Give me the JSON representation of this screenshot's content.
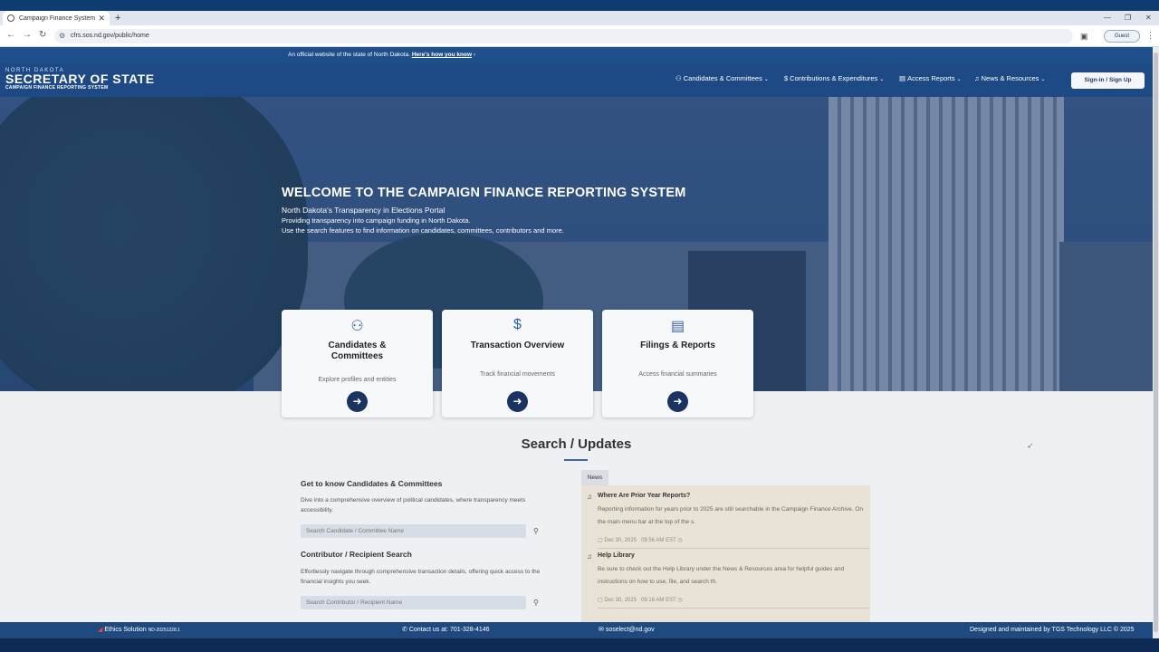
{
  "browser": {
    "tab_title": "Campaign Finance System",
    "url": "cfrs.sos.nd.gov/public/home",
    "profile_label": "Guest"
  },
  "banner": {
    "official_text": "An official website of the state of North Dakota.",
    "how_link": "Here's how you know"
  },
  "logo": {
    "line1": "NORTH DAKOTA",
    "line2": "SECRETARY OF STATE",
    "line3": "CAMPAIGN FINANCE REPORTING SYSTEM"
  },
  "nav": {
    "items": [
      {
        "label": "Candidates & Committees",
        "icon": "people-icon"
      },
      {
        "label": "Contributions & Expenditures",
        "icon": "dollar-icon"
      },
      {
        "label": "Access Reports",
        "icon": "document-icon"
      },
      {
        "label": "News & Resources",
        "icon": "bell-icon"
      }
    ],
    "signin_label": "Sign-in / Sign Up"
  },
  "hero": {
    "title": "WELCOME TO THE CAMPAIGN FINANCE REPORTING SYSTEM",
    "subtitle": "North Dakota's Transparency in Elections Portal",
    "line1": "Providing transparency into campaign funding in North Dakota.",
    "line2": "Use the search features to find information on candidates, committees, contributors and more."
  },
  "cards": [
    {
      "title_line1": "Candidates &",
      "title_line2": "Committees",
      "desc": "Explore profiles and entities",
      "icon": "people-icon"
    },
    {
      "title_line1": "Transaction Overview",
      "title_line2": "",
      "desc": "Track financial movements",
      "icon": "dollar-icon"
    },
    {
      "title_line1": "Filings & Reports",
      "title_line2": "",
      "desc": "Access financial summaries",
      "icon": "document-icon"
    }
  ],
  "search": {
    "section_title": "Search / Updates",
    "candidates_heading": "Get to know Candidates & Committees",
    "candidates_desc": "Dive into a comprehensive overview of political candidates, where transparency meets accessibility.",
    "candidates_placeholder": "Search Candidate / Committee Name",
    "contributor_heading": "Contributor / Recipient Search",
    "contributor_desc": "Effortlessly navigate through comprehensive transaction details, offering quick access to the financial insights you seek.",
    "contributor_placeholder": "Search Contributor / Recipient Name"
  },
  "news": {
    "tab_label": "News",
    "items": [
      {
        "title": "Where Are Prior Year Reports?",
        "body": "Reporting information for years prior to 2025 are still searchable in the Campaign Finance Archive. On the main menu bar at the top of the s.",
        "date": "Dec 30, 2025",
        "time": "09:56 AM EST"
      },
      {
        "title": "Help Library",
        "body": "Be sure to check out the Help Library under the News & Resources area for helpful guides and instructions on how to use, file, and search th.",
        "date": "Dec 30, 2025",
        "time": "09:16 AM EST"
      }
    ]
  },
  "footer": {
    "ethics": "Ethics Solution",
    "version": "ND-20251228.1",
    "contact": "Contact us at: 701-328-4146",
    "email": "soselect@nd.gov",
    "credit": "Designed and maintained by TGS Technology LLC © 2025"
  },
  "colors": {
    "header_blue": "#1d4a84",
    "arrow_navy": "#1b3360",
    "accent_blue": "#2f5fa8",
    "news_bg": "#e8e3d6"
  }
}
